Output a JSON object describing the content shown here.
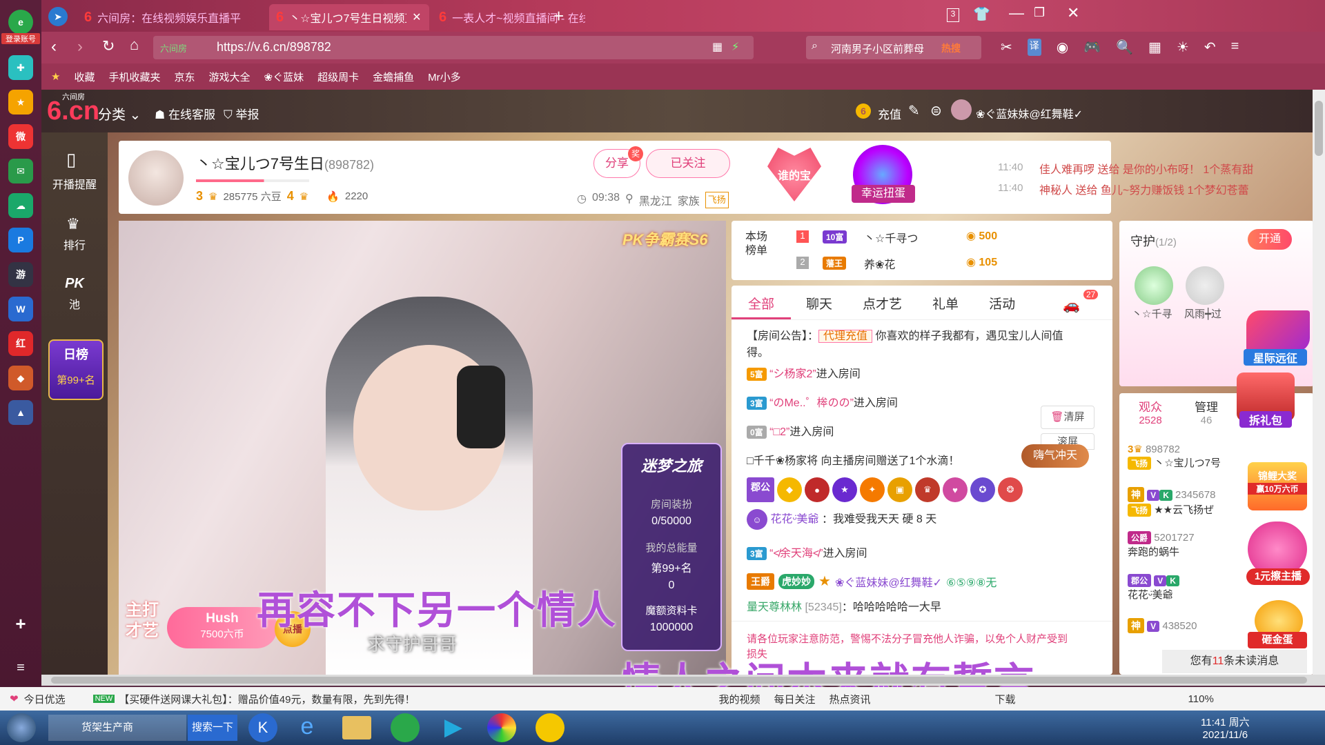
{
  "browser": {
    "left_badge": "登录账号",
    "tabs": [
      {
        "label": "六间房：在线视频娱乐直播平",
        "active": false
      },
      {
        "label": "丶☆宝儿つ7号生日视频直播间",
        "active": true
      },
      {
        "label": "一表人才~视频直播间 - 在线",
        "active": false
      }
    ],
    "new_tab": "+",
    "tab_counter": "3",
    "url_prefix": "六间房",
    "url": "https://v.6.cn/898782",
    "search_text": "河南男子小区前葬母",
    "search_hot": "热搜",
    "translate_label": "译",
    "bookmarks": [
      "收藏",
      "手机收藏夹",
      "京东",
      "游戏大全",
      "❀ぐ蓝妹",
      "超级周卡",
      "金蟾捕鱼",
      "Mr小多"
    ]
  },
  "site": {
    "logo_top": "六间房",
    "logo_main": "6.cn",
    "category": "分类",
    "service": "在线客服",
    "report": "举报",
    "recharge": "充值",
    "username": "❀ぐ蓝妹妹@红舞鞋✓"
  },
  "sidenav": {
    "start_remind": "开播提醒",
    "ranking": "排行",
    "pk": "PK",
    "pk_pool": "池",
    "daily": "日榜",
    "daily_rank": "第99+名"
  },
  "room": {
    "title": "丶☆宝儿つ7号生日",
    "room_id": "(898782)",
    "level_a": "3",
    "beans": "285775 六豆",
    "level_b": "4",
    "fire": "2220",
    "share": "分享",
    "share_badge": "奖",
    "followed": "已关注",
    "time": "09:38",
    "location": "黑龙江",
    "family_label": "家族",
    "family_name": "飞扬",
    "heart_label": "谁的宝",
    "lucky_label": "幸运扭蛋",
    "gifts": [
      {
        "time": "11:40",
        "text": "佳人难再啰 送给 是你的小布呀！ 1个蒸有甜"
      },
      {
        "time": "11:40",
        "text": "神秘人 送给 鱼儿~努力赚饭钱 1个梦幻苍蕾"
      }
    ]
  },
  "video": {
    "pk_badge": "PK争霸赛S6",
    "panel_title": "迷梦之旅",
    "decor_label": "房间装扮",
    "decor_value": "0/50000",
    "energy_label": "我的总能量",
    "energy_rank": "第99+名",
    "energy_value": "0",
    "card_label": "魔额资料卡",
    "card_value": "1000000",
    "song_tag": "主打才艺",
    "song_name": "Hush",
    "song_price": "7500六币",
    "song_btn": "点播",
    "lyric1": "再容不下另一个情人",
    "lyric_sub": "求守护哥哥",
    "lyric2": "情人之间本来就有誓言"
  },
  "rank": {
    "label": "本场榜单",
    "rows": [
      {
        "pos": "1",
        "badge": "10富",
        "name": "丶☆千寻つ",
        "score": "500"
      },
      {
        "pos": "2",
        "badge": "藩王",
        "name": "养❀花",
        "score": "105"
      }
    ]
  },
  "chat": {
    "tabs": [
      "全部",
      "聊天",
      "点才艺",
      "礼单",
      "活动"
    ],
    "car_badge": "27",
    "notice_prefix": "【房间公告】：",
    "notice_tag": "代理充值",
    "notice_text": "你喜欢的样子我都有，遇见宝儿人间值",
    "notice_text2": "得。",
    "clear": "清屏",
    "scroll": "滚屏",
    "atmosphere": "嗨气冲天",
    "lines": [
      {
        "badge": "5富",
        "name": "“シ杨家2”",
        "text": "进入房间"
      },
      {
        "badge": "3富",
        "name": "“のMe..゜桳のの”",
        "text": "进入房间"
      },
      {
        "badge": "0富",
        "name": "“□2”",
        "text": "进入房间"
      }
    ],
    "water": "□千千❀杨家将 向主播房间赠送了1个水滴！",
    "user1_name": "花花ᵕ̈美爺",
    "user1_msg": "：我难受我天天 硬 8 天",
    "line4_badge": "3富",
    "line4_name": "“≮余天海≮”",
    "line4_text": "进入房间",
    "king_badge": "王爵",
    "tiger": "虎妙妙",
    "self_name": "❀ぐ蓝妹妹@红舞鞋✓",
    "self_tail": "⑥⑤⑨⑧无",
    "msg5_name": "量天尊林林",
    "msg5_id": "[52345]",
    "msg5_text": "：哈哈哈哈哈一大早",
    "warning": "请各位玩家注意防范，警惕不法分子冒充他人诈骗，以免个人财产受到",
    "warning2": "损失"
  },
  "guard": {
    "title": "守护",
    "count": "(1/2)",
    "open": "开通",
    "members": [
      "丶☆千寻",
      "风雨┿过"
    ],
    "star_event": "星际远征",
    "gift_pack": "拆礼包"
  },
  "audience": {
    "tab1": "观众",
    "tab1_count": "2528",
    "tab2": "管理",
    "tab2_count": "46",
    "items": [
      {
        "id": "898782",
        "name": "丶☆宝儿つ7号"
      },
      {
        "id": "2345678",
        "name": "★★云飞扬ぜ"
      },
      {
        "id": "5201727",
        "name": "奔跑的蜗牛"
      },
      {
        "id": "",
        "name": "花花ᵕ̈美爺"
      },
      {
        "id": "438520",
        "name": ""
      }
    ],
    "promo1": "锦鲤大奖",
    "promo1b": "赢10万六币",
    "promo2": "1元擦主播",
    "promo3": "砸金蛋",
    "unread_prefix": "您有",
    "unread_count": "11",
    "unread_suffix": "条未读消息"
  },
  "statusbar": {
    "today": "今日优选",
    "new_tag": "NEW",
    "ad": "【买硬件送网课大礼包】：赠品价值49元，数量有限，先到先得！",
    "my_video": "我的视频",
    "daily_follow": "每日关注",
    "hot_news": "热点资讯",
    "download": "下载",
    "zoom": "110%"
  },
  "taskbar": {
    "app1": "货架生产商",
    "search_btn": "搜索一下",
    "time": "11:41 周六",
    "date": "2021/11/6"
  },
  "colors": {
    "accent": "#e0407a",
    "chrome": "#a43a5c",
    "gold": "#e89000"
  }
}
